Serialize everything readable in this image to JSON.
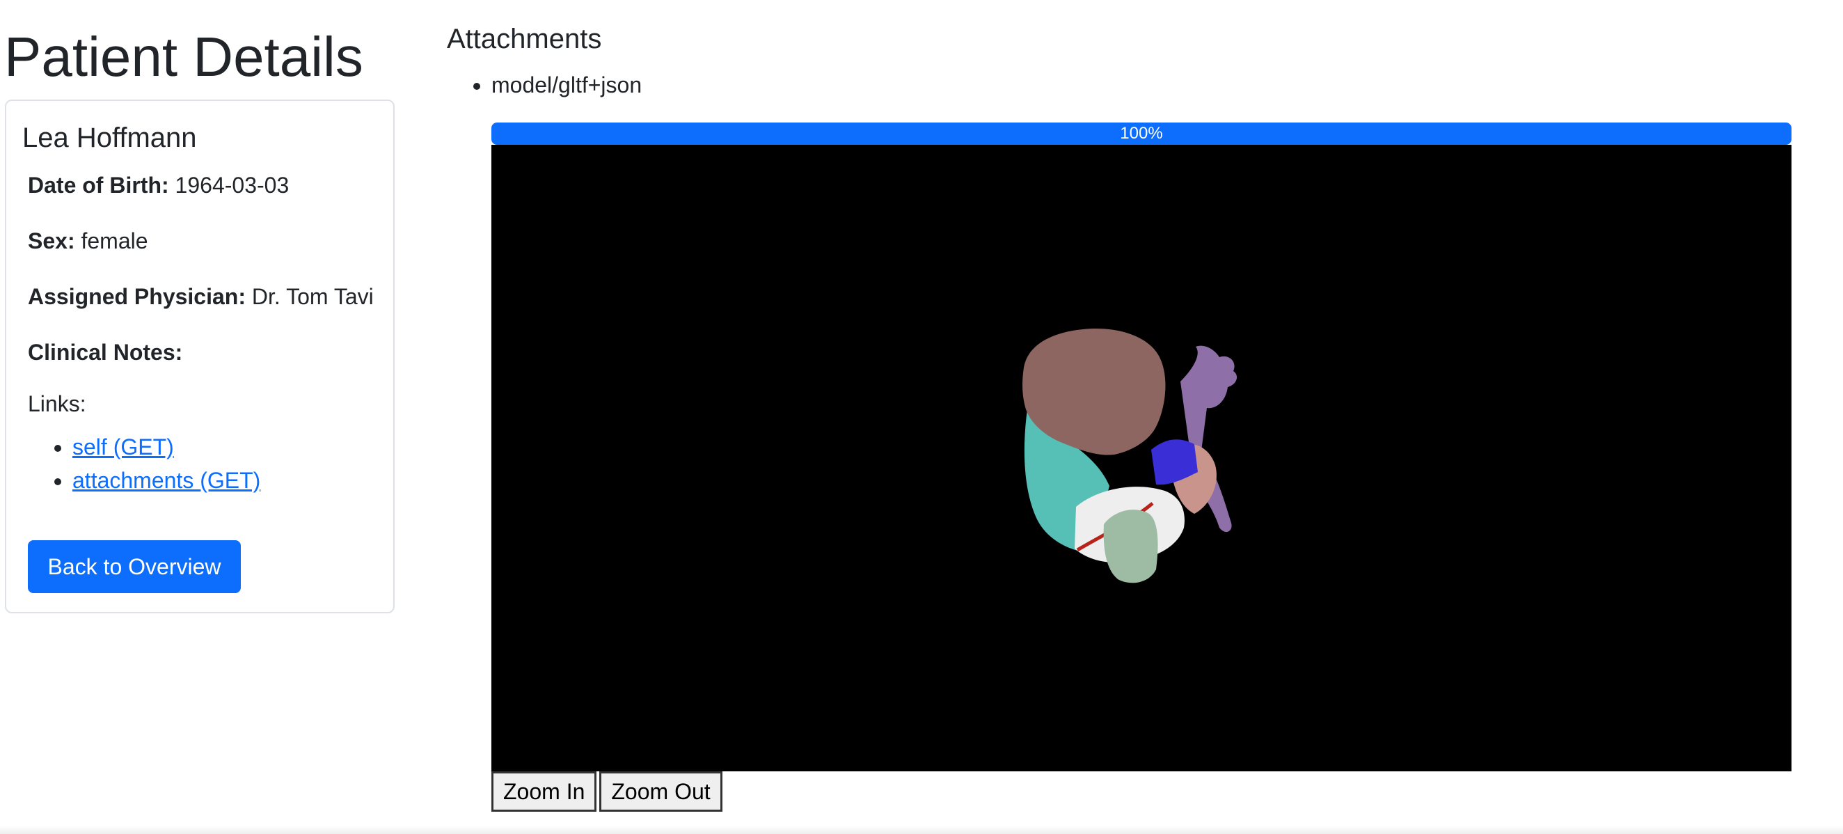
{
  "page": {
    "title": "Patient Details"
  },
  "patient": {
    "name": "Lea Hoffmann",
    "dob_label": "Date of Birth:",
    "dob_value": "1964-03-03",
    "sex_label": "Sex:",
    "sex_value": "female",
    "physician_label": "Assigned Physician:",
    "physician_value": "Dr. Tom Tavi",
    "notes_label": "Clinical Notes:",
    "notes_value": "",
    "links_label": "Links:",
    "links": [
      {
        "label": "self (GET)"
      },
      {
        "label": "attachments (GET)"
      }
    ],
    "back_button": "Back to Overview"
  },
  "attachments": {
    "title": "Attachments",
    "items": [
      {
        "mime": "model/gltf+json"
      }
    ],
    "progress": {
      "label": "100%",
      "percent": 100
    },
    "viewer": {
      "background": "#000000"
    },
    "zoom_in": "Zoom In",
    "zoom_out": "Zoom Out"
  },
  "colors": {
    "primary": "#0d6efd",
    "text": "#212529",
    "border": "#dee2e6"
  }
}
